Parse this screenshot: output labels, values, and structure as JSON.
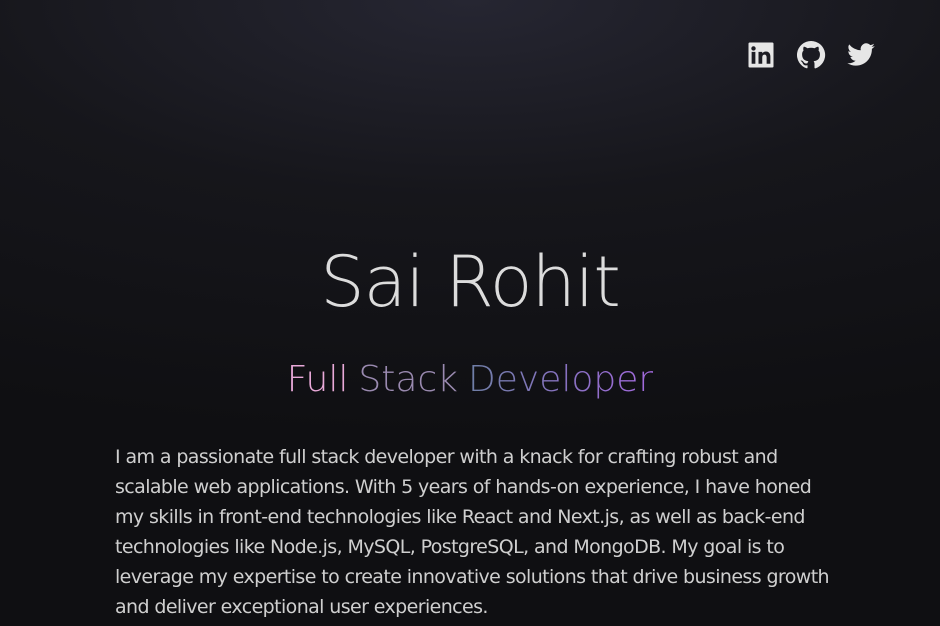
{
  "socials": [
    {
      "name": "LinkedIn",
      "icon": "linkedin-icon"
    },
    {
      "name": "GitHub",
      "icon": "github-icon"
    },
    {
      "name": "Twitter",
      "icon": "twitter-icon"
    }
  ],
  "hero": {
    "name": "Sai Rohit",
    "role": {
      "word1": "Full",
      "word2": "Stack",
      "word3": "Developer"
    },
    "bio": "I am a passionate full stack developer with a knack for crafting robust and scalable web applications. With 5 years of hands-on experience, I have honed my skills in front-end technologies like React and Next.js, as well as back-end technologies like Node.js, MySQL, PostgreSQL, and MongoDB. My goal is to leverage my expertise to create innovative solutions that drive business growth and deliver exceptional user experiences."
  },
  "colors": {
    "background": "#16161b",
    "role_full": "#e9a9d9",
    "role_stack": "#9a8ab0",
    "role_developer_start": "#6f7fa6",
    "role_developer_end": "#a46ae0"
  }
}
